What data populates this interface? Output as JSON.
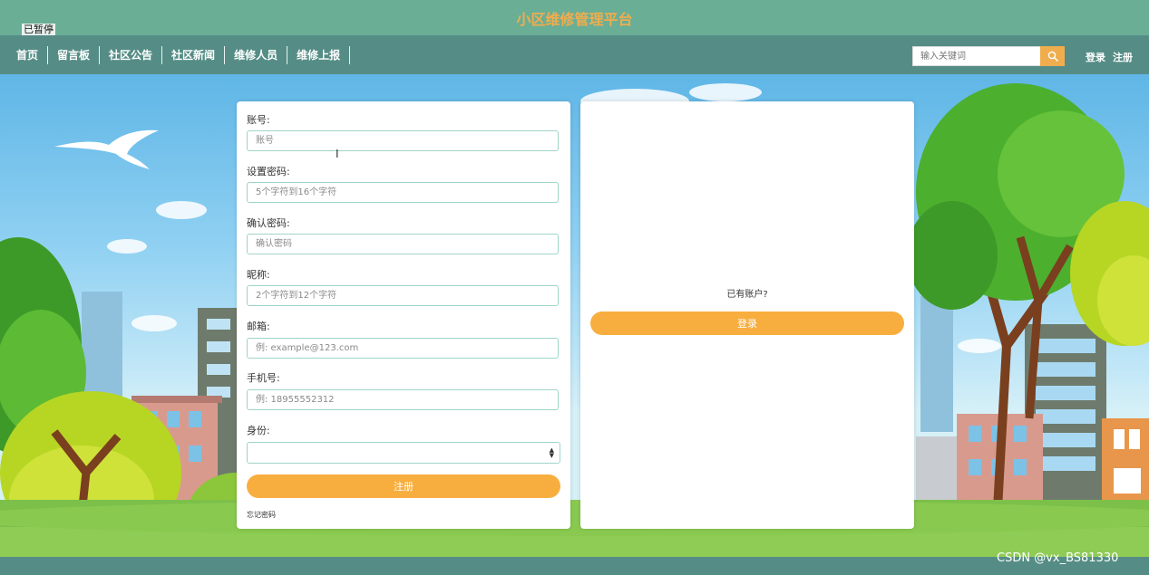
{
  "header": {
    "site_title": "小区维修管理平台",
    "paused_badge": "已暂停"
  },
  "nav": {
    "items": [
      "首页",
      "留言板",
      "社区公告",
      "社区新闻",
      "维修人员",
      "维修上报"
    ]
  },
  "search": {
    "placeholder": "输入关键词",
    "icon": "search-icon"
  },
  "auth": {
    "login": "登录",
    "register": "注册"
  },
  "register_form": {
    "fields": [
      {
        "label": "账号:",
        "placeholder": "账号"
      },
      {
        "label": "设置密码:",
        "placeholder": "5个字符到16个字符"
      },
      {
        "label": "确认密码:",
        "placeholder": "确认密码"
      },
      {
        "label": "昵称:",
        "placeholder": "2个字符到12个字符"
      },
      {
        "label": "邮箱:",
        "placeholder": "例: example@123.com"
      },
      {
        "label": "手机号:",
        "placeholder": "例: 18955552312"
      }
    ],
    "role_label": "身份:",
    "role_value": "",
    "submit": "注册",
    "forgot": "忘记密码"
  },
  "login_panel": {
    "prompt": "已有账户?",
    "button": "登录"
  },
  "watermark": "CSDN @vx_BS81330",
  "colors": {
    "header_bg": "#6aae96",
    "nav_bg": "#558d86",
    "accent": "#f8ae3f",
    "input_border": "#9fd4c8"
  }
}
